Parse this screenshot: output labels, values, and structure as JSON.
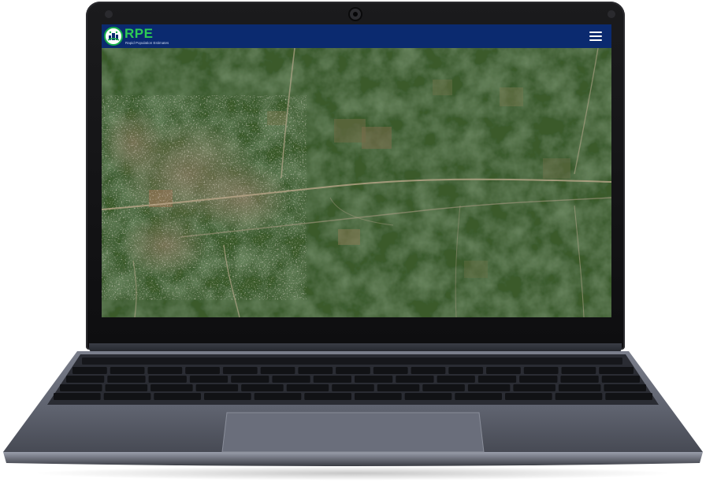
{
  "app": {
    "logo_text": "RPE",
    "logo_tagline": "Rapid Population Estimates",
    "logo_icon": "rpe-emblem-icon",
    "menu_icon": "hamburger-menu-icon"
  },
  "colors": {
    "navbar": "#0b2a6f",
    "logo_green": "#2ecc55",
    "map_vegetation": "#2f4a24",
    "laptop_body": "#5a5e6b"
  },
  "map": {
    "type": "satellite imagery",
    "content": "aerial view of a settlement along roads surrounded by vegetation"
  }
}
